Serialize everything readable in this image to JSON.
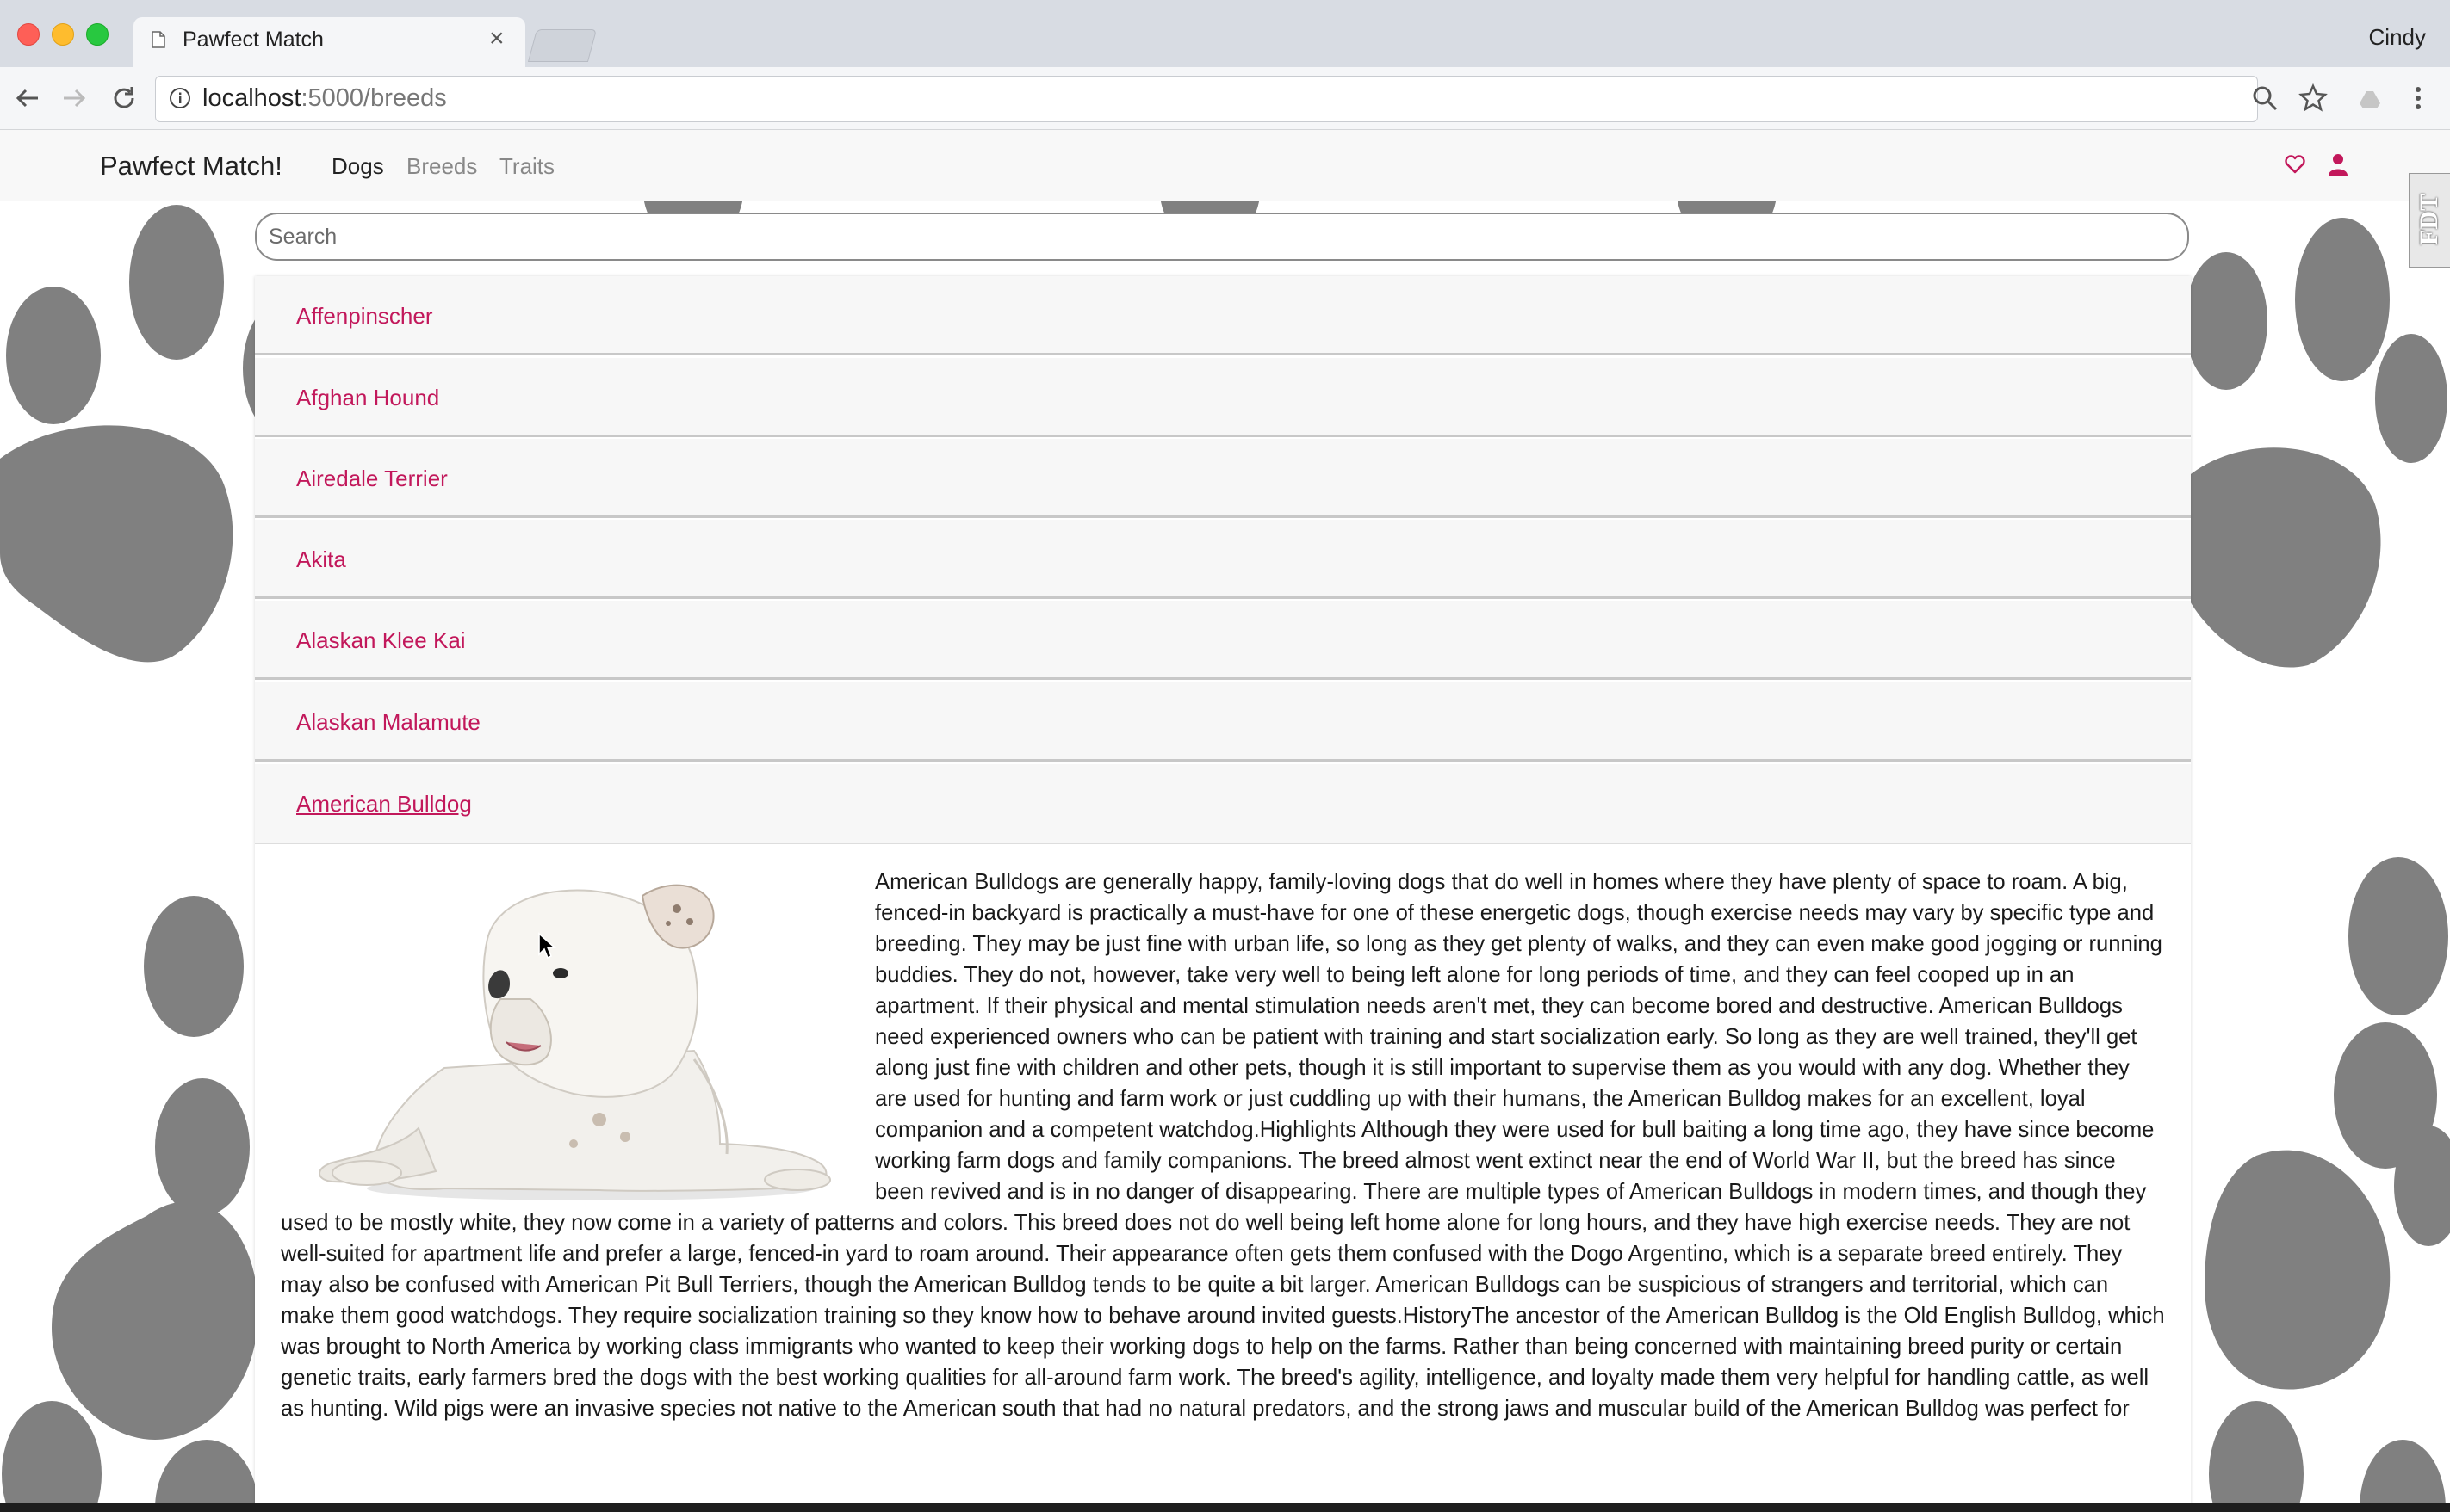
{
  "browser": {
    "tab_title": "Pawfect Match",
    "profile_name": "Cindy",
    "address_host": "localhost",
    "address_rest": ":5000/breeds"
  },
  "navbar": {
    "brand": "Pawfect Match!",
    "links": [
      "Dogs",
      "Breeds",
      "Traits"
    ],
    "accent_color": "#c2185b"
  },
  "fdt_widget": "FDT",
  "search": {
    "placeholder": "Search"
  },
  "breeds": [
    "Affenpinscher",
    "Afghan Hound",
    "Airedale Terrier",
    "Akita",
    "Alaskan Klee Kai",
    "Alaskan Malamute",
    "American Bulldog"
  ],
  "expanded_breed": {
    "name": "American Bulldog",
    "description": "American Bulldogs are generally happy, family-loving dogs that do well in homes where they have plenty of space to roam. A big, fenced-in backyard is practically a must-have for one of these energetic dogs, though exercise needs may vary by specific type and breeding. They may be just fine with urban life, so long as they get plenty of walks, and they can even make good jogging or running buddies. They do not, however, take very well to being left alone for long periods of time, and they can feel cooped up in an apartment. If their physical and mental stimulation needs aren't met, they can become bored and destructive. American Bulldogs need experienced owners who can be patient with training and start socialization early. So long as they are well trained, they'll get along just fine with children and other pets, though it is still important to supervise them as you would with any dog. Whether they are used for hunting and farm work or just cuddling up with their humans, the American Bulldog makes for an excellent, loyal companion and a competent watchdog.Highlights Although they were used for bull baiting a long time ago, they have since become working farm dogs and family companions. The breed almost went extinct near the end of World War II, but the breed has since been revived and is in no danger of disappearing. There are multiple types of American Bulldogs in modern times, and though they used to be mostly white, they now come in a variety of patterns and colors. This breed does not do well being left home alone for long hours, and they have high exercise needs. They are not well-suited for apartment life and prefer a large, fenced-in yard to roam around. Their appearance often gets them confused with the Dogo Argentino, which is a separate breed entirely. They may also be confused with American Pit Bull Terriers, though the American Bulldog tends to be quite a bit larger. American Bulldogs can be suspicious of strangers and territorial, which can make them good watchdogs. They require socialization training so they know how to behave around invited guests.HistoryThe ancestor of the American Bulldog is the Old English Bulldog, which was brought to North America by working class immigrants who wanted to keep their working dogs to help on the farms. Rather than being concerned with maintaining breed purity or certain genetic traits, early farmers bred the dogs with the best working qualities for all-around farm work. The breed's agility, intelligence, and loyalty made them very helpful for handling cattle, as well as hunting. Wild pigs were an invasive species not native to the American south that had no natural predators, and the strong jaws and muscular build of the American Bulldog was perfect for hunting them down. There is a sad part of the American Bulldog's history, too. They were originally used in the barbaric sport of bull baiting. By the end of World War II, the American Bulldog was almost extinct until a few breeders scoured the south for specimens to revive the breed. Today, the American Bulldog is in no danger of extinction and is mostly a family"
  }
}
